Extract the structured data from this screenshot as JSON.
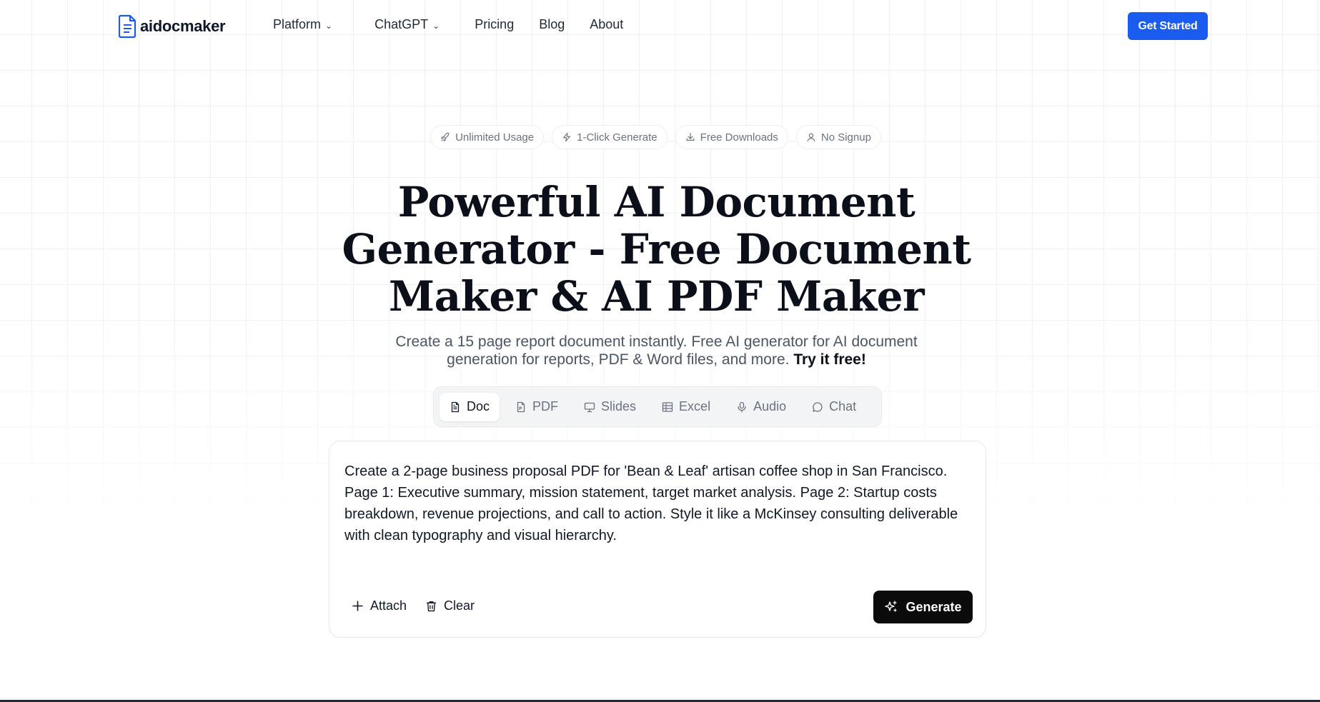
{
  "brand": {
    "name": "aidocmaker",
    "accent": "#1a5cf0"
  },
  "nav": {
    "links": [
      {
        "label": "Platform",
        "has_dropdown": true
      },
      {
        "label": "ChatGPT",
        "has_dropdown": true
      },
      {
        "label": "Pricing",
        "has_dropdown": false
      },
      {
        "label": "Blog",
        "has_dropdown": false
      },
      {
        "label": "About",
        "has_dropdown": false
      }
    ],
    "cta_label": "Get Started"
  },
  "badges": [
    {
      "label": "Unlimited Usage",
      "icon": "rocket-icon"
    },
    {
      "label": "1-Click Generate",
      "icon": "lightning-icon"
    },
    {
      "label": "Free Downloads",
      "icon": "download-icon"
    },
    {
      "label": "No Signup",
      "icon": "user-icon"
    }
  ],
  "hero": {
    "title": "Powerful AI Document Generator - Free Document Maker & AI PDF Maker",
    "subtitle": "Create a 15 page report document instantly. Free AI generator for AI document generation for reports, PDF & Word files, and more.",
    "subtitle_emphasis": "Try it free!"
  },
  "tabs": [
    {
      "label": "Doc",
      "icon": "document-icon",
      "active": true
    },
    {
      "label": "PDF",
      "icon": "pdf-file-icon",
      "active": false
    },
    {
      "label": "Slides",
      "icon": "presentation-icon",
      "active": false
    },
    {
      "label": "Excel",
      "icon": "table-icon",
      "active": false
    },
    {
      "label": "Audio",
      "icon": "microphone-icon",
      "active": false
    },
    {
      "label": "Chat",
      "icon": "chat-bubble-icon",
      "active": false
    }
  ],
  "editor": {
    "value": "Create a 2-page business proposal PDF for 'Bean & Leaf' artisan coffee shop in San Francisco. Page 1: Executive summary, mission statement, target market analysis. Page 2: Startup costs breakdown, revenue projections, and call to action. Style it like a McKinsey consulting deliverable with clean typography and visual hierarchy.",
    "attach_label": "Attach",
    "clear_label": "Clear",
    "generate_label": "Generate"
  }
}
